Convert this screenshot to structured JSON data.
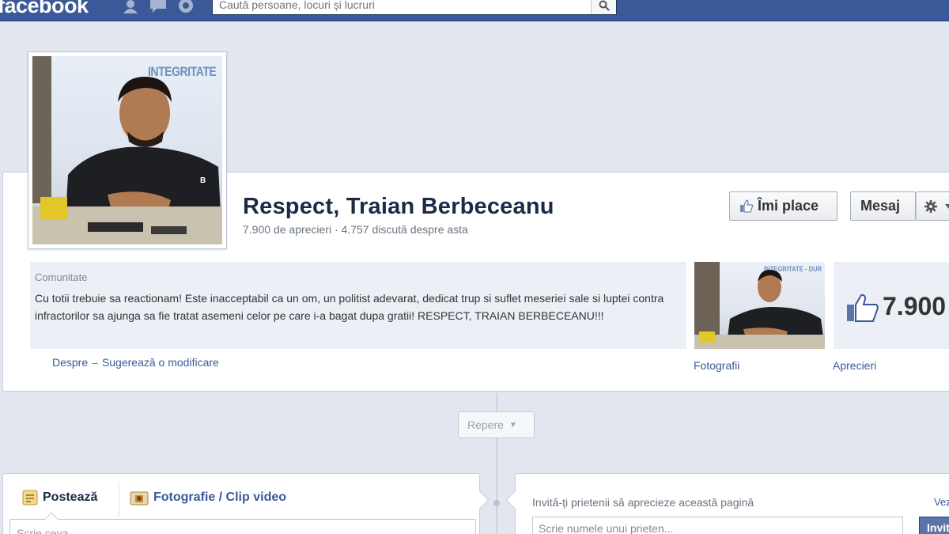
{
  "topbar": {
    "logo": "facebook",
    "search_placeholder": "Caută persoane, locuri și lucruri",
    "icons": [
      "friend-requests-icon",
      "messages-icon",
      "notifications-icon",
      "search-icon"
    ]
  },
  "page": {
    "photo_stamp": "INTEGRITATE",
    "name": "Respect, Traian Berbeceanu",
    "stats": "7.900 de aprecieri · 4.757 discută despre asta",
    "buttons": {
      "like": "Îmi place",
      "message": "Mesaj"
    },
    "about": {
      "category": "Comunitate",
      "text": "Cu totii trebuie sa reactionam! Este inacceptabil ca un om, un politist adevarat, dedicat trup si suflet meseriei sale si luptei contra infractorilor sa ajunga sa fie tratat asemeni celor pe care i-a bagat dupa gratii! RESPECT, TRAIAN BERBECEANU!!!",
      "link_about": "Despre",
      "link_separator": "–",
      "link_suggest": "Sugerează o modificare"
    },
    "thumbnails": {
      "photos_label": "Fotografii",
      "photos_stamp": "INTEGRITATE - DUR",
      "likes_label": "Aprecieri",
      "likes_count": "7.900"
    }
  },
  "timeline": {
    "selector": "Repere"
  },
  "composer": {
    "tab_post": "Postează",
    "tab_photo": "Fotografie / Clip video",
    "input_placeholder": "Scrie ceva..."
  },
  "invite": {
    "title": "Invită-ți prietenii să aprecieze această pagină",
    "link": "Vezi",
    "input_placeholder": "Scrie numele unui prieten...",
    "button": "Invită"
  },
  "colors": {
    "brand_blue": "#3b5998",
    "page_bg": "#e3e6ee",
    "link": "#3b5998",
    "title": "#1c2a47"
  }
}
